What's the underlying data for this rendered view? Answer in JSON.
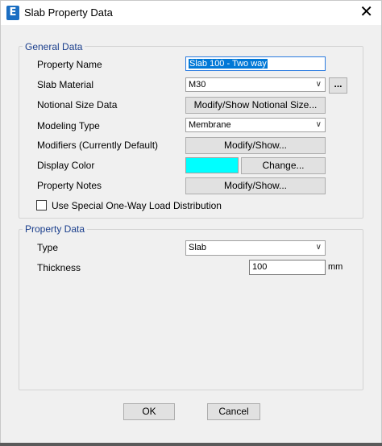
{
  "window": {
    "title": "Slab Property Data",
    "icon_letter": "E",
    "close_glyph": "✕"
  },
  "general": {
    "title": "General Data",
    "property_name_label": "Property Name",
    "property_name_value": "Slab 100 - Two way",
    "slab_material_label": "Slab Material",
    "slab_material_value": "M30",
    "material_more_button": "...",
    "notional_label": "Notional Size Data",
    "notional_button": "Modify/Show Notional Size...",
    "modeling_label": "Modeling Type",
    "modeling_value": "Membrane",
    "modifiers_label": "Modifiers (Currently Default)",
    "modifiers_button": "Modify/Show...",
    "color_label": "Display Color",
    "display_color": "#00ffff",
    "change_button": "Change...",
    "notes_label": "Property Notes",
    "notes_button": "Modify/Show...",
    "special_checkbox_label": "Use Special One-Way Load Distribution"
  },
  "property": {
    "title": "Property Data",
    "type_label": "Type",
    "type_value": "Slab",
    "thickness_label": "Thickness",
    "thickness_value": "100",
    "thickness_unit": "mm"
  },
  "footer": {
    "ok": "OK",
    "cancel": "Cancel"
  },
  "icons": {
    "dropdown": "chevron-down-icon"
  }
}
